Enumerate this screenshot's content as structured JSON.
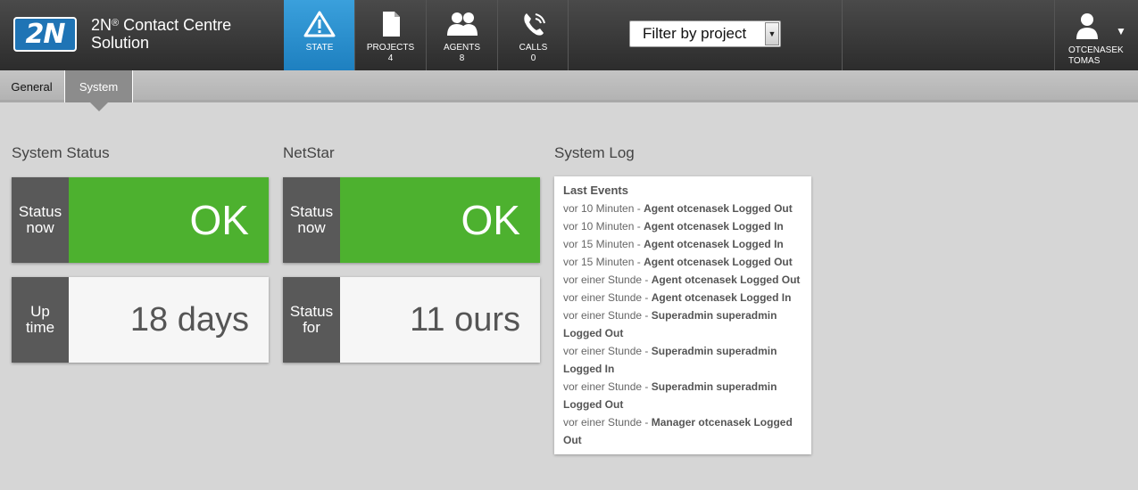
{
  "header": {
    "logo_text": "2N",
    "title_line1": "2N",
    "title_sup": "®",
    "title_line1_rest": " Contact Centre",
    "title_line2": "Solution",
    "tabs": [
      {
        "label": "STATE",
        "count": "",
        "icon": "warning-triangle-icon"
      },
      {
        "label": "PROJECTS",
        "count": "4",
        "icon": "document-icon"
      },
      {
        "label": "AGENTS",
        "count": "8",
        "icon": "people-icon"
      },
      {
        "label": "CALLS",
        "count": "0",
        "icon": "phone-icon"
      }
    ],
    "filter": {
      "value": "Filter by project"
    },
    "user": {
      "name_line1": "OTCENASEK",
      "name_line2": "TOMAS"
    }
  },
  "subnav": {
    "tabs": [
      {
        "label": "General"
      },
      {
        "label": "System"
      }
    ]
  },
  "system_status": {
    "title": "System Status",
    "status_label_1": "Status",
    "status_label_2": "now",
    "status_value": "OK",
    "uptime_label_1": "Up",
    "uptime_label_2": "time",
    "uptime_value": "18 days"
  },
  "netstar": {
    "title": "NetStar",
    "status_label_1": "Status",
    "status_label_2": "now",
    "status_value": "OK",
    "for_label_1": "Status",
    "for_label_2": "for",
    "for_value": "11 ours"
  },
  "system_log": {
    "title": "System Log",
    "heading": "Last Events",
    "entries": [
      {
        "time": "vor 10 Minuten",
        "sep": " - ",
        "event": "Agent otcenasek Logged Out"
      },
      {
        "time": "vor 10 Minuten",
        "sep": " - ",
        "event": "Agent otcenasek Logged In"
      },
      {
        "time": "vor 15 Minuten",
        "sep": " - ",
        "event": "Agent otcenasek Logged In"
      },
      {
        "time": "vor 15 Minuten",
        "sep": " - ",
        "event": "Agent otcenasek Logged Out"
      },
      {
        "time": "vor einer Stunde",
        "sep": " - ",
        "event": "Agent otcenasek Logged Out"
      },
      {
        "time": "vor einer Stunde",
        "sep": " - ",
        "event": "Agent otcenasek Logged In"
      },
      {
        "time": "vor einer Stunde",
        "sep": " - ",
        "event": "Superadmin superadmin Logged Out"
      },
      {
        "time": "vor einer Stunde",
        "sep": " - ",
        "event": "Superadmin superadmin Logged In"
      },
      {
        "time": "vor einer Stunde",
        "sep": " - ",
        "event": "Superadmin superadmin Logged Out"
      },
      {
        "time": "vor einer Stunde",
        "sep": " - ",
        "event": "Manager otcenasek Logged Out"
      }
    ]
  },
  "colors": {
    "accent": "#1e80c0",
    "ok_green": "#4db12f",
    "dark": "#595959"
  }
}
